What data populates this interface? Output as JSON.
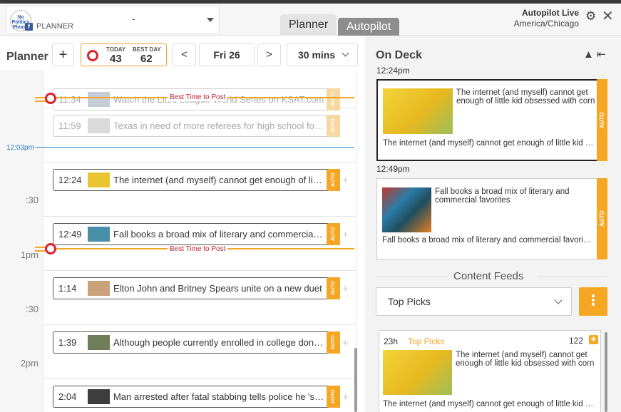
{
  "header": {
    "page": {
      "avatar_text": "No Politics Please",
      "fb_badge": "f",
      "type": "PLANNER",
      "value": "-"
    },
    "tabs": [
      {
        "label": "Planner"
      },
      {
        "label": "Autopilot"
      }
    ],
    "autopilot": {
      "status": "Autopilot Live",
      "timezone": "America/Chicago"
    }
  },
  "planner": {
    "title": "Planner",
    "add_label": "+",
    "score": {
      "today_label": "TODAY",
      "today_value": "43",
      "best_label": "BEST DAY",
      "best_value": "62"
    },
    "prev_label": "<",
    "date_label": "Fri 26",
    "next_label": ">",
    "interval_label": "30 mins",
    "now_label": "12:03pm",
    "best_time_label": "Best Time to Post",
    "time_labels": [
      ":30",
      "1pm",
      ":30",
      "2pm"
    ],
    "posts": [
      {
        "time": "11:34",
        "text": "Watch the Little League World Series on KSAT.com",
        "auto": "AUTO",
        "thumb": "#8a9bb0"
      },
      {
        "time": "11:59",
        "text": "Texas in need of more referees for high school football",
        "auto": "AUTO",
        "thumb": "#b5b5b5"
      },
      {
        "time": "12:24",
        "text": "The internet (and myself) cannot get enough of little kid obsessed with corn",
        "auto": "AUTO",
        "thumb": "#e8c531"
      },
      {
        "time": "12:49",
        "text": "Fall books a broad mix of literary and commercial favorites",
        "auto": "AUTO",
        "thumb": "#4a8fa8"
      },
      {
        "time": "1:14",
        "text": "Elton John and Britney Spears unite on a new duet",
        "auto": "AUTO",
        "thumb": "#c9a27a"
      },
      {
        "time": "1:39",
        "text": "Although people currently enrolled in college don't know it yet",
        "auto": "AUTO",
        "thumb": "#6f7d58"
      },
      {
        "time": "2:04",
        "text": "Man arrested after fatal stabbing tells police he 'snapped'",
        "auto": "AUTO",
        "thumb": "#3d3d3d"
      }
    ]
  },
  "on_deck": {
    "title": "On Deck",
    "collapse_label": "▲ ⇤",
    "slots": [
      {
        "time": "12:24pm",
        "title": "The internet (and myself) cannot get enough of little kid obsessed with corn",
        "desc": "The internet (and myself) cannot get enough of little kid obsessed with corn",
        "auto": "AUTO"
      },
      {
        "time": "12:49pm",
        "title": "Fall books a broad mix of literary and commercial favorites",
        "desc": "Fall books a broad mix of literary and commercial favorites",
        "auto": "AUTO"
      }
    ]
  },
  "content_feeds": {
    "title": "Content Feeds",
    "selected": "Top Picks",
    "menu_label": "⋮",
    "item": {
      "age": "23h",
      "source": "Top Picks",
      "count": "122",
      "title": "The internet (and myself) cannot get enough of little kid obsessed with corn",
      "desc": "The internet (and myself) cannot get enough of little kid obsessed with corn"
    }
  },
  "colors": {
    "accent": "#f5a623",
    "now_line": "#2b7cc4",
    "best_time": "#d9232d"
  }
}
